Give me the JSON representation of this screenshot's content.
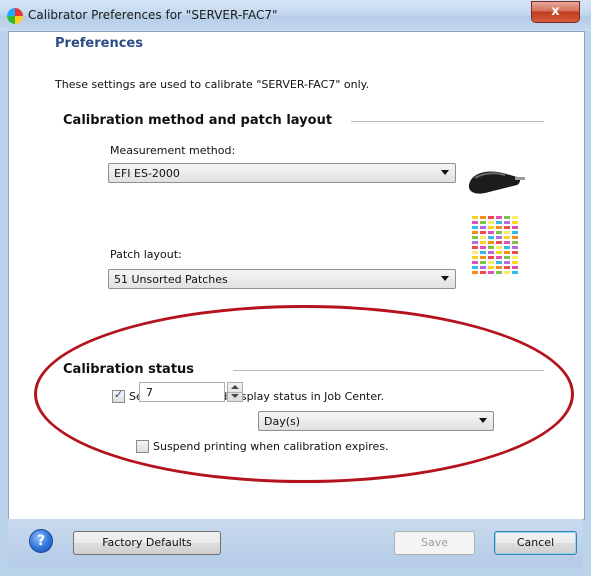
{
  "window": {
    "title": "Calibrator Preferences for \"SERVER-FAC7\"",
    "close_glyph": "x"
  },
  "content": {
    "heading": "Preferences",
    "description": "These settings are used to calibrate \"SERVER-FAC7\" only."
  },
  "calibration_method": {
    "group_title": "Calibration method and patch layout",
    "measurement_label": "Measurement method:",
    "measurement_value": "EFI ES-2000",
    "patch_label": "Patch layout:",
    "patch_value": "51 Unsorted Patches"
  },
  "calibration_status": {
    "group_title": "Calibration status",
    "time_limit_checkbox_label": "Set time limit and display status in Job Center.",
    "time_limit_checked": true,
    "time_value": "7",
    "unit_value": "Day(s)",
    "suspend_checkbox_label": "Suspend printing when calibration expires.",
    "suspend_checked": false
  },
  "footer": {
    "help_glyph": "?",
    "factory_defaults_label": "Factory Defaults",
    "save_label": "Save",
    "cancel_label": "Cancel"
  },
  "colors": {
    "heading": "#2a4d86",
    "annotation_ellipse": "#b4131c"
  },
  "icons": {
    "title": "calibrator-app-icon",
    "device": "spectrophotometer-icon",
    "patches": "patch-layout-icon",
    "help": "help-icon"
  }
}
